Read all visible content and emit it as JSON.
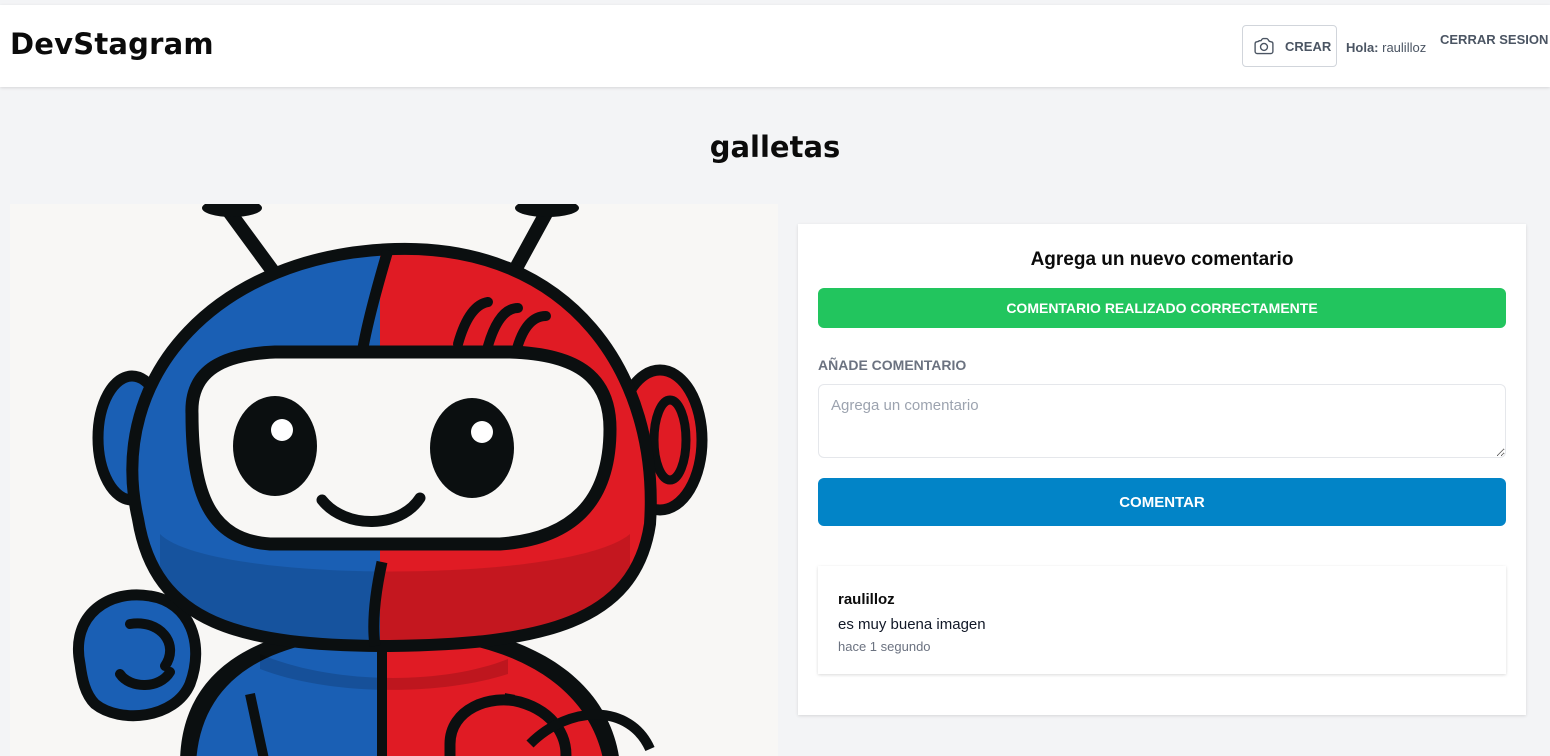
{
  "header": {
    "brand": "DevStagram",
    "create_button": {
      "icon": "camera-icon",
      "label": "CREAR"
    },
    "greeting_prefix": "Hola:",
    "username": "raulilloz",
    "logout_label": "CERRAR SESION"
  },
  "post": {
    "title": "galletas",
    "image": {
      "subject": "robot-mascot",
      "colors": {
        "blue": "#1a5fb4",
        "red": "#e01b24",
        "outline": "#0b0f10",
        "background": "#f8f7f5"
      }
    }
  },
  "comment_form": {
    "heading": "Agrega un nuevo comentario",
    "success_message": "COMENTARIO REALIZADO CORRECTAMENTE",
    "field_label": "AÑADE COMENTARIO",
    "placeholder": "Agrega un comentario",
    "value": "",
    "submit_label": "COMENTAR"
  },
  "comments": [
    {
      "user": "raulilloz",
      "text": "es muy buena imagen",
      "time": "hace 1 segundo"
    }
  ],
  "colors": {
    "page_bg": "#f3f4f6",
    "success": "#22c55e",
    "primary": "#0284c7",
    "muted_text": "#6b7280"
  }
}
